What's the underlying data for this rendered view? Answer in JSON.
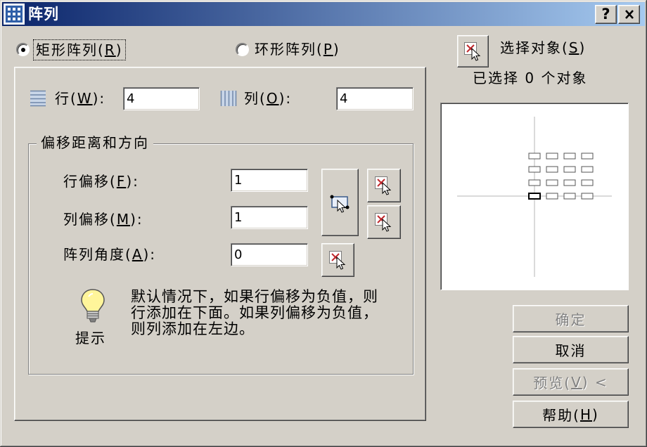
{
  "window": {
    "title": "阵列",
    "help_glyph": "?",
    "app_icon": "array-dialog-icon",
    "close_icon": "close-icon"
  },
  "array_type": {
    "rectangular": {
      "label": "矩形阵列(R)",
      "checked": true
    },
    "polar": {
      "label": "环形阵列(P)",
      "checked": false
    }
  },
  "rows": {
    "label": "行(W):",
    "value": "4",
    "icon": "rows-icon"
  },
  "columns": {
    "label": "列(O):",
    "value": "4",
    "icon": "columns-icon"
  },
  "offset": {
    "group_title": "偏移距离和方向",
    "row_offset": {
      "label": "行偏移(F):",
      "value": "1"
    },
    "column_offset": {
      "label": "列偏移(M):",
      "value": "1"
    },
    "angle": {
      "label": "阵列角度(A):",
      "value": "0"
    },
    "pick_both_icon": "pick-both-offsets-icon",
    "pick_one_icon": "pick-point-icon"
  },
  "tip": {
    "label": "提示",
    "icon": "lightbulb-icon",
    "lines": [
      "默认情况下，如果行偏移为负值，则",
      "行添加在下面。如果列偏移为负值，",
      "则列添加在左边。"
    ]
  },
  "selection": {
    "label": "选择对象(S)",
    "status": "已选择 0 个对象",
    "icon": "select-objects-icon"
  },
  "preview": {
    "rows": 4,
    "columns": 4
  },
  "actions": {
    "ok": {
      "label": "确定",
      "enabled": false
    },
    "cancel": {
      "label": "取消",
      "enabled": true
    },
    "preview": {
      "label": "预览(V) <",
      "enabled": false
    },
    "help": {
      "label": "帮助(H)",
      "enabled": true
    }
  },
  "colors": {
    "face": "#d4d0c8",
    "title_start": "#0a246a",
    "title_end": "#a6caf0",
    "title_text": "#ffffff",
    "disabled_text": "#808080",
    "highlight": "#ffffff",
    "shadow": "#808080",
    "dark_shadow": "#404040"
  }
}
